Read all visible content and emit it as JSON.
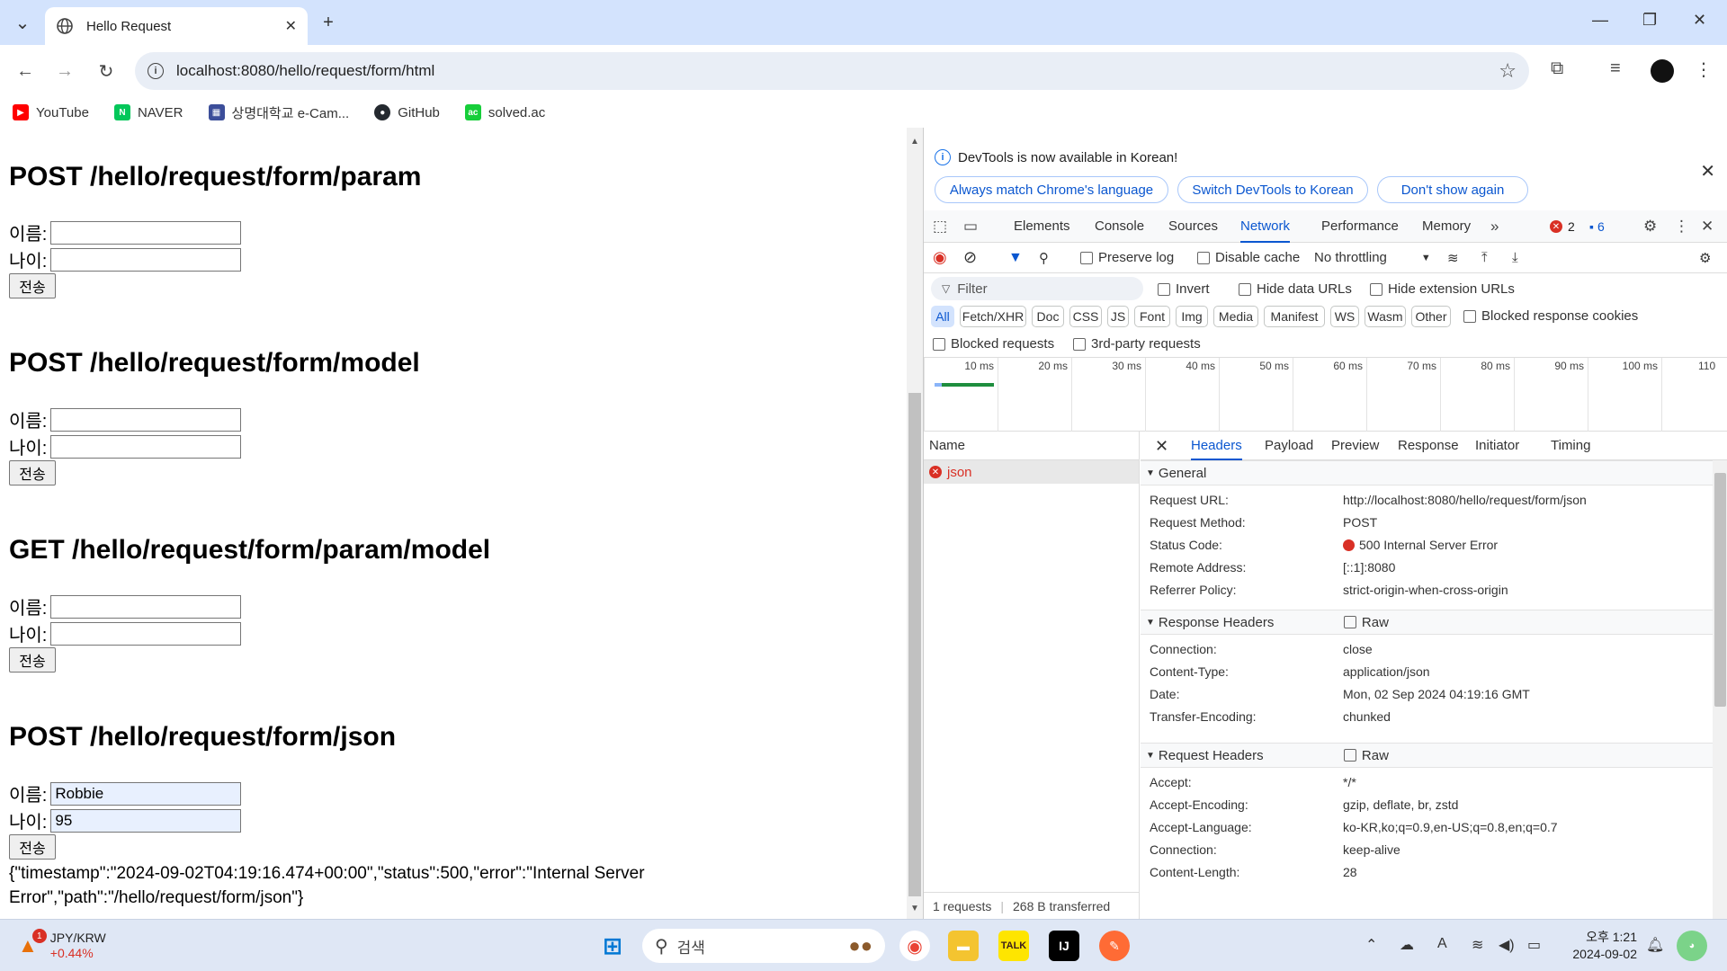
{
  "browser": {
    "tab_title": "Hello Request",
    "url": "localhost:8080/hello/request/form/html",
    "bookmarks": [
      {
        "label": "YouTube",
        "color": "#ff0000"
      },
      {
        "label": "NAVER",
        "color": "#03c75a"
      },
      {
        "label": "상명대학교 e-Cam...",
        "color": "#3c4e9a"
      },
      {
        "label": "GitHub",
        "color": "#24292f"
      },
      {
        "label": "solved.ac",
        "color": "#17ce3a"
      }
    ]
  },
  "page": {
    "sections": [
      {
        "title": "POST /hello/request/form/param",
        "name_label": "이름:",
        "age_label": "나이:",
        "name_value": "",
        "age_value": "",
        "submit": "전송"
      },
      {
        "title": "POST /hello/request/form/model",
        "name_label": "이름:",
        "age_label": "나이:",
        "name_value": "",
        "age_value": "",
        "submit": "전송"
      },
      {
        "title": "GET /hello/request/form/param/model",
        "name_label": "이름:",
        "age_label": "나이:",
        "name_value": "",
        "age_value": "",
        "submit": "전송"
      },
      {
        "title": "POST /hello/request/form/json",
        "name_label": "이름:",
        "age_label": "나이:",
        "name_value": "Robbie",
        "age_value": "95",
        "submit": "전송"
      }
    ],
    "result_text": "{\"timestamp\":\"2024-09-02T04:19:16.474+00:00\",\"status\":500,\"error\":\"Internal Server Error\",\"path\":\"/hello/request/form/json\"}"
  },
  "devtools": {
    "infobar": {
      "message": "DevTools is now available in Korean!",
      "buttons": [
        "Always match Chrome's language",
        "Switch DevTools to Korean",
        "Don't show again"
      ]
    },
    "tabs": [
      "Elements",
      "Console",
      "Sources",
      "Network",
      "Performance",
      "Memory"
    ],
    "active_tab": "Network",
    "error_count": "2",
    "message_count": "6",
    "network": {
      "preserve_log": "Preserve log",
      "disable_cache": "Disable cache",
      "throttling": "No throttling",
      "filter_placeholder": "Filter",
      "invert": "Invert",
      "hide_data_urls": "Hide data URLs",
      "hide_extension_urls": "Hide extension URLs",
      "types": [
        "All",
        "Fetch/XHR",
        "Doc",
        "CSS",
        "JS",
        "Font",
        "Img",
        "Media",
        "Manifest",
        "WS",
        "Wasm",
        "Other"
      ],
      "blocked_response_cookies": "Blocked response cookies",
      "blocked_requests": "Blocked requests",
      "third_party": "3rd-party requests",
      "timeline_ticks": [
        "10 ms",
        "20 ms",
        "30 ms",
        "40 ms",
        "50 ms",
        "60 ms",
        "70 ms",
        "80 ms",
        "90 ms",
        "100 ms",
        "110"
      ],
      "list_header": "Name",
      "request_name": "json",
      "footer_requests": "1 requests",
      "footer_transferred": "268 B transferred"
    },
    "detail": {
      "subtabs": [
        "Headers",
        "Payload",
        "Preview",
        "Response",
        "Initiator",
        "Timing"
      ],
      "active_subtab": "Headers",
      "general_title": "General",
      "general": [
        {
          "k": "Request URL:",
          "v": "http://localhost:8080/hello/request/form/json"
        },
        {
          "k": "Request Method:",
          "v": "POST"
        },
        {
          "k": "Status Code:",
          "v": "500 Internal Server Error"
        },
        {
          "k": "Remote Address:",
          "v": "[::1]:8080"
        },
        {
          "k": "Referrer Policy:",
          "v": "strict-origin-when-cross-origin"
        }
      ],
      "response_title": "Response Headers",
      "raw_label": "Raw",
      "response": [
        {
          "k": "Connection:",
          "v": "close"
        },
        {
          "k": "Content-Type:",
          "v": "application/json"
        },
        {
          "k": "Date:",
          "v": "Mon, 02 Sep 2024 04:19:16 GMT"
        },
        {
          "k": "Transfer-Encoding:",
          "v": "chunked"
        }
      ],
      "request_title": "Request Headers",
      "request": [
        {
          "k": "Accept:",
          "v": "*/*"
        },
        {
          "k": "Accept-Encoding:",
          "v": "gzip, deflate, br, zstd"
        },
        {
          "k": "Accept-Language:",
          "v": "ko-KR,ko;q=0.9,en-US;q=0.8,en;q=0.7"
        },
        {
          "k": "Connection:",
          "v": "keep-alive"
        },
        {
          "k": "Content-Length:",
          "v": "28"
        }
      ]
    }
  },
  "taskbar": {
    "stock_name": "JPY/KRW",
    "stock_change": "+0.44%",
    "stock_badge": "1",
    "search_placeholder": "검색",
    "time_ampm": "오후 1:21",
    "date": "2024-09-02",
    "ime": "A"
  }
}
